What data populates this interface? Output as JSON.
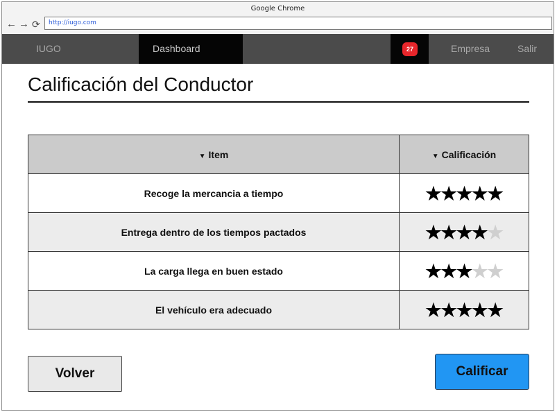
{
  "window": {
    "title": "Google Chrome"
  },
  "browser": {
    "url": "http://iugo.com",
    "icons": {
      "back": "arrow-left-icon",
      "forward": "arrow-right-icon",
      "reload": "reload-icon"
    }
  },
  "nav": {
    "brand": "IUGO",
    "dashboard": "Dashboard",
    "notifications_count": "27",
    "company": "Empresa",
    "logout": "Salir"
  },
  "page": {
    "title": "Calificación del Conductor"
  },
  "table": {
    "columns": [
      "Item",
      "Calificación"
    ],
    "rows": [
      {
        "item": "Recoge la mercancia a tiempo",
        "rating": 5,
        "max": 5
      },
      {
        "item": "Entrega dentro de los tiempos pactados",
        "rating": 4,
        "max": 5
      },
      {
        "item": "La carga llega en buen estado",
        "rating": 3,
        "max": 5
      },
      {
        "item": "El vehículo era adecuado",
        "rating": 5,
        "max": 5
      }
    ]
  },
  "actions": {
    "back_label": "Volver",
    "rate_label": "Calificar"
  },
  "colors": {
    "navbar": "#4b4b4b",
    "nav_active": "#050505",
    "badge": "#e8262b",
    "primary_button": "#2196f3",
    "header_row": "#cbcbcb",
    "alt_row": "#ececec"
  }
}
